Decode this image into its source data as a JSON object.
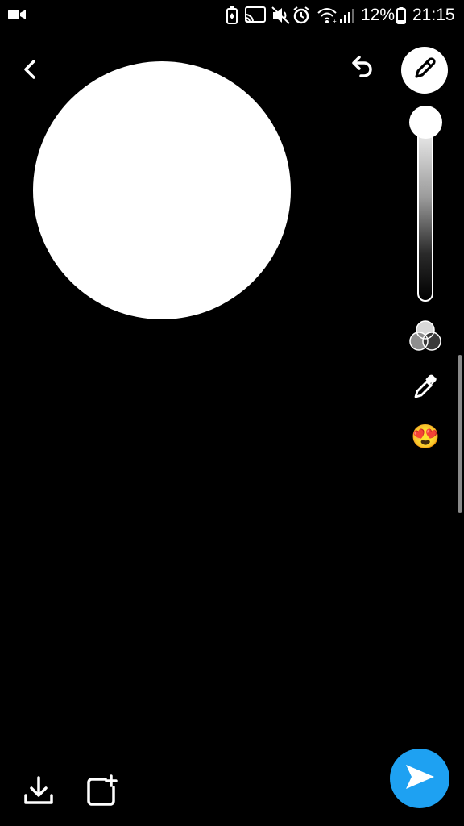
{
  "status_bar": {
    "battery_percent": "12%",
    "time": "21:15",
    "icons": [
      "video-camera-icon",
      "battery-saver-icon",
      "cast-icon",
      "mute-icon",
      "alarm-icon",
      "wifi-icon",
      "signal-icon",
      "battery-icon"
    ]
  },
  "toolbar": {
    "back_icon": "chevron-left-icon",
    "undo_icon": "undo-icon",
    "pencil_icon": "pencil-icon"
  },
  "canvas": {
    "drawn_shape": "circle",
    "drawn_color": "#ffffff"
  },
  "brush_size": {
    "level": 1.0
  },
  "tools": {
    "color_palette_icon": "color-palette-icon",
    "eyedropper_icon": "eyedropper-icon",
    "emoji": "😍"
  },
  "bottom_bar": {
    "save_icon": "download-icon",
    "story_icon": "add-to-story-icon",
    "send_icon": "send-arrow-icon"
  },
  "colors": {
    "background": "#000000",
    "send_button": "#1ea1f2",
    "foreground": "#ffffff"
  }
}
